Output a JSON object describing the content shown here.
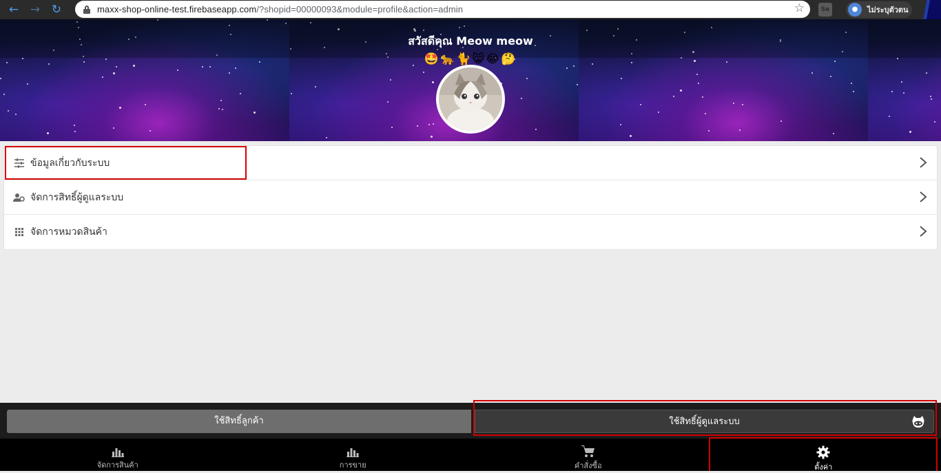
{
  "browser": {
    "url_host": "maxx-shop-online-test.firebaseapp.com",
    "url_path": "/?shopid=00000093&module=profile&action=admin",
    "profile_label": "ไม่ระบุตัวตน",
    "ext_label": "Se"
  },
  "banner": {
    "greeting": "สวัสดีคุณ Meow meow",
    "emojis": "🤩🐆🐈😸😂🤔"
  },
  "menu": {
    "items": [
      {
        "label": "ข้อมูลเกี่ยวกับระบบ",
        "icon": "sliders-icon"
      },
      {
        "label": "จัดการสิทธิ์ผู้ดูแลระบบ",
        "icon": "users-cog-icon"
      },
      {
        "label": "จัดการหมวดสินค้า",
        "icon": "grid-icon"
      }
    ]
  },
  "role": {
    "customer_label": "ใช้สิทธิ์ลูกค้า",
    "admin_label": "ใช้สิทธิ์ผู้ดูแลระบบ"
  },
  "bottom_nav": {
    "items": [
      {
        "label": "จัดการสินค้า",
        "icon": "bar-chart-icon"
      },
      {
        "label": "การขาย",
        "icon": "bar-chart-icon"
      },
      {
        "label": "คำสั่งซื้อ",
        "icon": "cart-icon"
      },
      {
        "label": "ตั้งค่า",
        "icon": "gear-icon",
        "active": true
      }
    ]
  },
  "colors": {
    "highlight": "#d40000",
    "banner_dark": "#0c1330",
    "nav_bg": "#000000"
  }
}
